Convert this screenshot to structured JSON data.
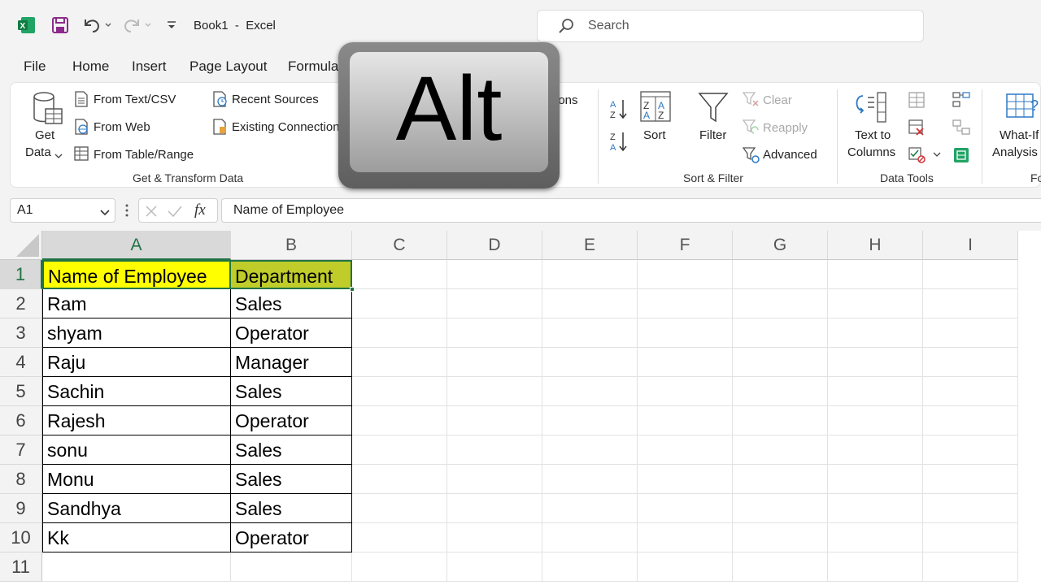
{
  "titlebar": {
    "title": "Book1  -  Excel",
    "search_placeholder": "Search"
  },
  "menu": [
    "File",
    "Home",
    "Insert",
    "Page Layout",
    "Formula"
  ],
  "ribbon": {
    "get_data_line1": "Get",
    "get_data_line2": "Data",
    "from_text_csv": "From Text/CSV",
    "from_web": "From Web",
    "from_table_range": "From Table/Range",
    "recent_sources": "Recent Sources",
    "existing_connections": "Existing Connection",
    "group_get_transform": "Get & Transform Data",
    "queries_fragment": "ions",
    "sort": "Sort",
    "filter": "Filter",
    "clear": "Clear",
    "reapply": "Reapply",
    "advanced": "Advanced",
    "group_sort_filter": "Sort & Filter",
    "text_to_columns_line1": "Text to",
    "text_to_columns_line2": "Columns",
    "group_data_tools": "Data Tools",
    "whatif_line1": "What-If",
    "whatif_line2": "Analysis",
    "group_forecast_fragment": "Fo"
  },
  "formula_bar": {
    "name_box": "A1",
    "fx_label": "fx",
    "content": "Name of Employee"
  },
  "columns": [
    "A",
    "B",
    "C",
    "D",
    "E",
    "F",
    "G",
    "H",
    "I"
  ],
  "rows": [
    "1",
    "2",
    "3",
    "4",
    "5",
    "6",
    "7",
    "8",
    "9",
    "10",
    "11"
  ],
  "table": [
    [
      "Name of Employee",
      "Department"
    ],
    [
      "Ram",
      "Sales"
    ],
    [
      "shyam",
      "Operator"
    ],
    [
      "Raju",
      "Manager"
    ],
    [
      "Sachin",
      "Sales"
    ],
    [
      "Rajesh",
      "Operator"
    ],
    [
      "sonu",
      "Sales"
    ],
    [
      "Monu",
      "Sales"
    ],
    [
      "Sandhya",
      "Sales"
    ],
    [
      "Kk",
      "Operator"
    ]
  ],
  "overlay_key": "Alt",
  "colors": {
    "header_fill_a": "#ffff00",
    "header_fill_b": "#bfcc2a",
    "accent": "#217346"
  }
}
